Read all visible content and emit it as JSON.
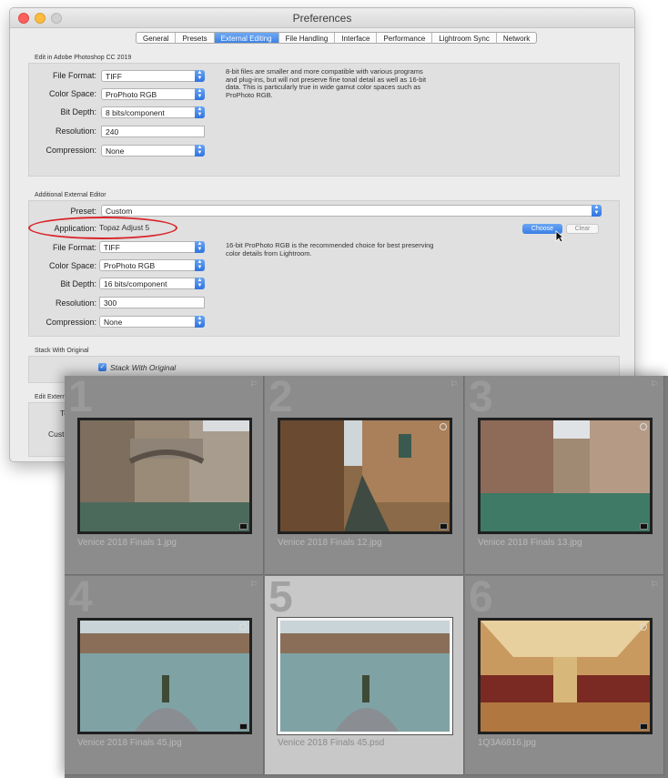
{
  "window": {
    "title": "Preferences"
  },
  "tabs": [
    "General",
    "Presets",
    "External Editing",
    "File Handling",
    "Interface",
    "Performance",
    "Lightroom Sync",
    "Network"
  ],
  "active_tab": "External Editing",
  "edit_in_section": {
    "label": "Edit in Adobe Photoshop CC 2019",
    "file_format_label": "File Format:",
    "file_format": "TIFF",
    "color_space_label": "Color Space:",
    "color_space": "ProPhoto RGB",
    "bit_depth_label": "Bit Depth:",
    "bit_depth": "8 bits/component",
    "resolution_label": "Resolution:",
    "resolution": "240",
    "compression_label": "Compression:",
    "compression": "None",
    "help_text": "8-bit files are smaller and more compatible with various programs and plug-ins, but will not preserve fine tonal detail as well as 16-bit data. This is particularly true in wide gamut color spaces such as ProPhoto RGB."
  },
  "additional_section": {
    "label": "Additional External Editor",
    "preset_label": "Preset:",
    "preset": "Custom",
    "application_label": "Application:",
    "application": "Topaz Adjust 5",
    "choose_label": "Choose",
    "clear_label": "Clear",
    "file_format_label": "File Format:",
    "file_format": "TIFF",
    "color_space_label": "Color Space:",
    "color_space": "ProPhoto RGB",
    "bit_depth_label": "Bit Depth:",
    "bit_depth": "16 bits/component",
    "resolution_label": "Resolution:",
    "resolution": "300",
    "compression_label": "Compression:",
    "compression": "None",
    "help_text": "16-bit ProPhoto RGB is the recommended choice for best preserving color details from Lightroom."
  },
  "stack_section": {
    "label": "Stack With Original",
    "checkbox_label": "Stack With Original",
    "checked": true
  },
  "edit_external_section": {
    "label": "Edit Extern",
    "row1_label": "Te",
    "row2_label": "Custo"
  },
  "grid": {
    "cells": [
      {
        "num": "1",
        "name": "Venice 2018 Finals 1.jpg",
        "selected": false
      },
      {
        "num": "2",
        "name": "Venice 2018 Finals 12.jpg",
        "selected": false
      },
      {
        "num": "3",
        "name": "Venice 2018 Finals 13.jpg",
        "selected": false
      },
      {
        "num": "4",
        "name": "Venice 2018 Finals 45.jpg",
        "selected": false
      },
      {
        "num": "5",
        "name": "Venice 2018 Finals 45.psd",
        "selected": true
      },
      {
        "num": "6",
        "name": "1Q3A6816.jpg",
        "selected": false
      }
    ]
  },
  "colors": {
    "accent": "#3d82e6",
    "highlight_ellipse": "#d9252b",
    "grid_bg": "#8c8c8c",
    "selected_cell": "#c8c8c8"
  }
}
